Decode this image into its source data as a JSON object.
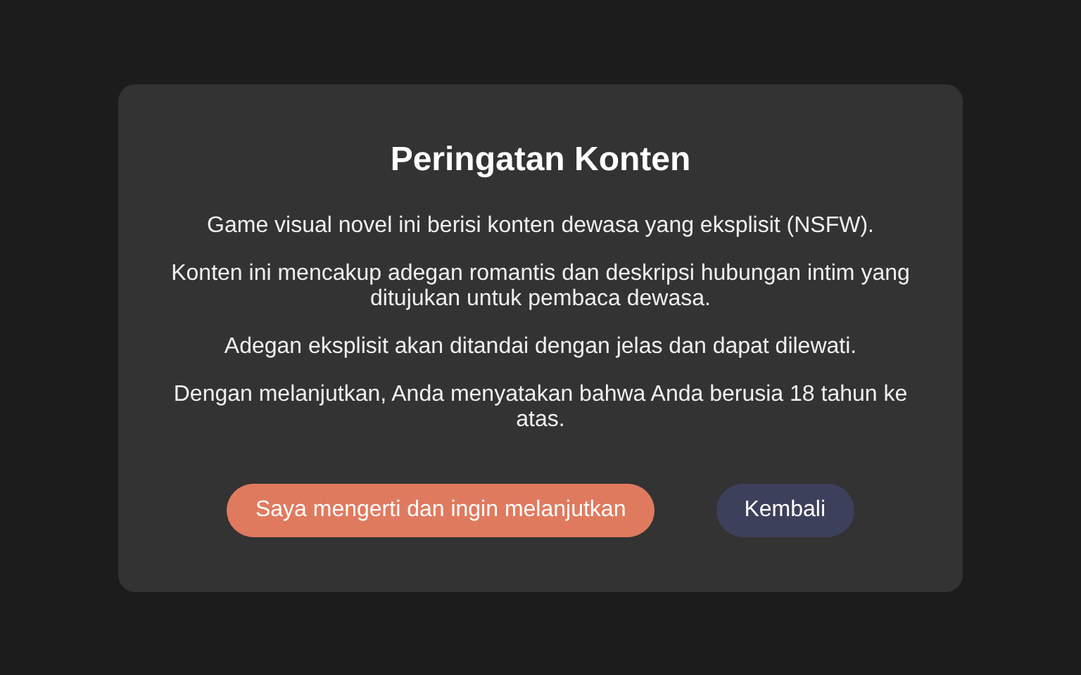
{
  "dialog": {
    "title": "Peringatan Konten",
    "paragraphs": [
      "Game visual novel ini berisi konten dewasa yang eksplisit (NSFW).",
      "Konten ini mencakup adegan romantis dan deskripsi hubungan intim yang ditujukan untuk pembaca dewasa.",
      "Adegan eksplisit akan ditandai dengan jelas dan dapat dilewati.",
      "Dengan melanjutkan, Anda menyatakan bahwa Anda berusia 18 tahun ke atas."
    ],
    "buttons": [
      {
        "label": "Saya mengerti dan ingin melanjutkan",
        "kind": "primary"
      },
      {
        "label": "Kembali",
        "kind": "secondary"
      }
    ]
  }
}
